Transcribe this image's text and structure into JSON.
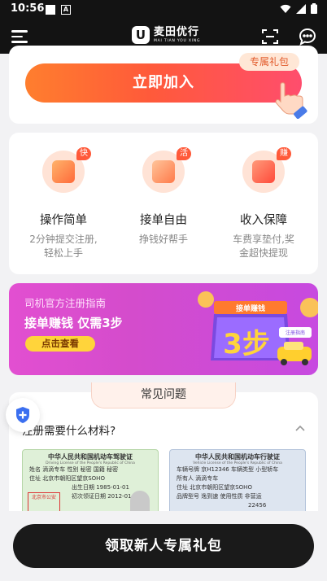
{
  "status_bar": {
    "time": "10:56",
    "notif_badge": "A"
  },
  "header": {
    "brand_title": "麦田优行",
    "brand_sub": "MAI TIAN YOU XING",
    "logo_letter": "U"
  },
  "join": {
    "label": "立即加入",
    "gift_tag": "专属礼包"
  },
  "features": [
    {
      "badge": "快",
      "title": "操作简单",
      "desc1": "2分钟提交注册,",
      "desc2": "轻松上手"
    },
    {
      "badge": "活",
      "title": "接单自由",
      "desc1": "挣钱好帮手",
      "desc2": ""
    },
    {
      "badge": "赚",
      "title": "收入保障",
      "desc1": "车费享垫付,奖",
      "desc2": "金超快提现"
    }
  ],
  "banner": {
    "line1": "司机官方注册指南",
    "line2": "接单赚钱 仅需3步",
    "button": "点击查看",
    "ribbon": "接单赚钱",
    "big": "3步",
    "tag": "注册指南"
  },
  "faq": {
    "title": "常见问题",
    "question": "注册需要什么材料?",
    "license1": {
      "title": "中华人民共和国机动车驾驶证",
      "subtitle": "Driving License of the People's Republic of China",
      "name_row": "姓名  滴滴专车    性别  秘密    国籍  秘密",
      "addr_row": "住址  北京市朝阳区望京SOHO",
      "birth_row": "出生日期  1985-01-01",
      "issue_row": "初次领证日期  2012-01-01",
      "stamp": "北京市公安"
    },
    "license2": {
      "title": "中华人民共和国机动车行驶证",
      "subtitle": "Vehicle License of the People's Republic of China",
      "row1": "车辆号牌  京H12346    车辆类型  小型轿车",
      "row2": "所有人  滴滴专车",
      "row3": "住址  北京市朝阳区望京SOHO",
      "row4": "品牌型号  逸到速    使用性质  非营运",
      "row5": "22456"
    }
  },
  "cta": {
    "label": "领取新人专属礼包"
  }
}
